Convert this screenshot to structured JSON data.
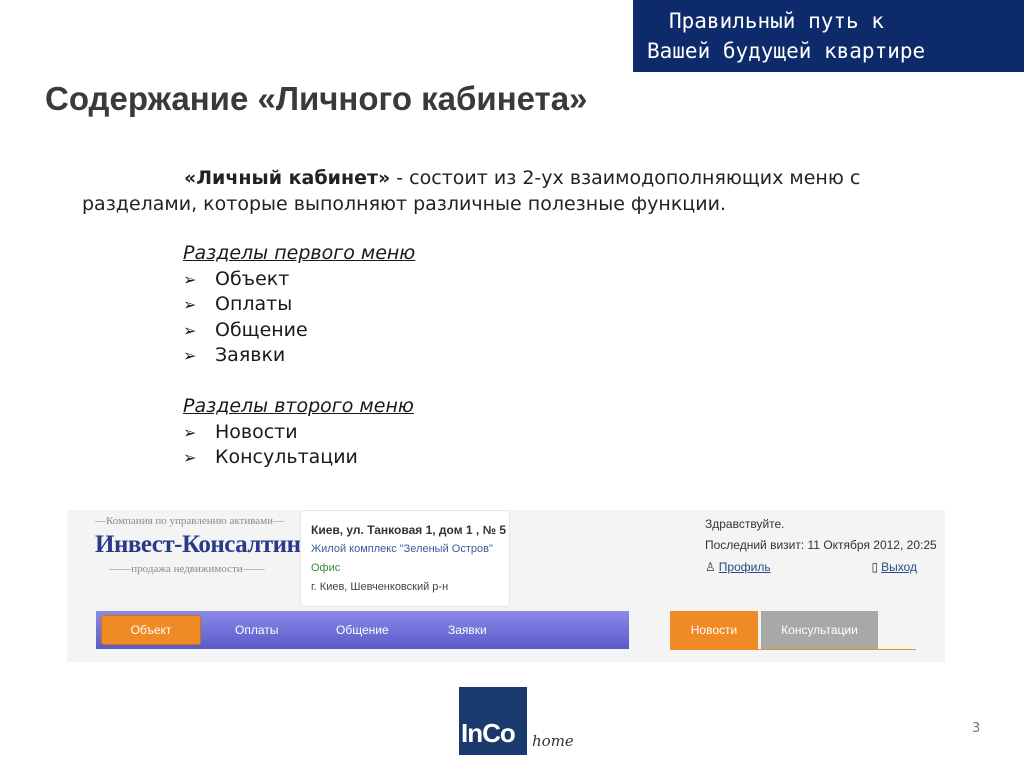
{
  "slogan": {
    "line1": "Правильный путь к",
    "line2": "Вашей будущей квартире"
  },
  "title": "Содержание «Личного кабинета»",
  "intro": {
    "bold": "«Личный кабинет»",
    "text": " - состоит из 2-ух взаимодополняющих меню с разделами, которые выполняют различные полезные функции."
  },
  "menu1": {
    "heading": "Разделы первого меню",
    "items": [
      "Объект",
      "Оплаты",
      "Общение",
      "Заявки"
    ]
  },
  "menu2": {
    "heading": "Разделы второго меню",
    "items": [
      "Новости",
      "Консультации"
    ]
  },
  "bullet_glyph": "➢",
  "site": {
    "logo_top": "—Компания по управлению активами—",
    "logo_main": "Инвест-Консалтинг",
    "logo_bottom": "——продажа недвижимости——",
    "address": {
      "line1": "Киев, ул. Танковая 1, дом 1 , № 5",
      "line2": "Жилой комплекс \"Зеленый Остров\"",
      "line3": "Офис",
      "line4": "г. Киев, Шевченковский р-н"
    },
    "greeting": "Здравствуйте.",
    "last_visit": "Последний визит: 11 Октября 2012, 20:25",
    "profile_link": "Профиль",
    "logout_link": "Выход",
    "nav1": [
      "Объект",
      "Оплаты",
      "Общение",
      "Заявки"
    ],
    "nav2": [
      "Новости",
      "Консультации"
    ],
    "colors": {
      "nav_blue": "#6a6ad8",
      "nav_orange": "#f08a24",
      "nav_gray": "#a8a8a8"
    }
  },
  "brand": {
    "main": "InCo",
    "sub": "home"
  },
  "page_number": "3"
}
